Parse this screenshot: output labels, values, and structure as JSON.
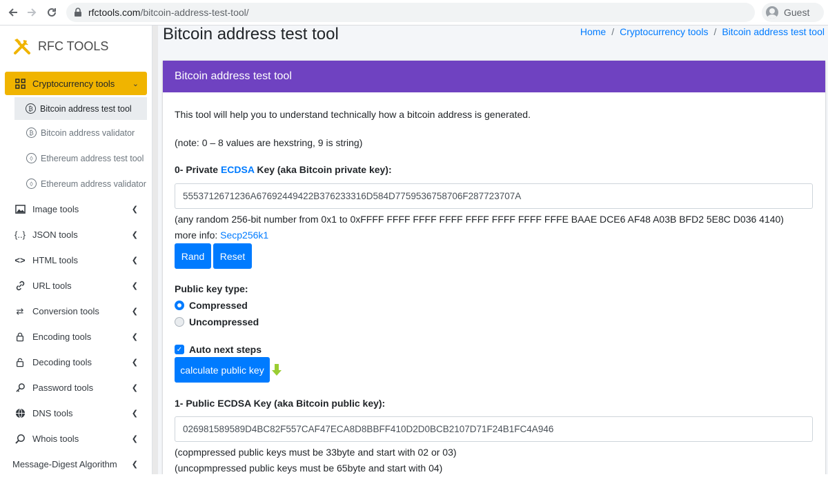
{
  "browser": {
    "url_host": "rfctools.com",
    "url_path": "/bitcoin-address-test-tool/",
    "profile_label": "Guest"
  },
  "sidebar": {
    "brand": "RFC TOOLS",
    "items": [
      {
        "label": "Cryptocurrency tools",
        "icon": "grid-icon",
        "active": true
      },
      {
        "label": "Image tools",
        "icon": "image-icon"
      },
      {
        "label": "JSON tools",
        "icon": "braces-icon"
      },
      {
        "label": "HTML tools",
        "icon": "code-icon"
      },
      {
        "label": "URL tools",
        "icon": "link-icon"
      },
      {
        "label": "Conversion tools",
        "icon": "sync-icon"
      },
      {
        "label": "Encoding tools",
        "icon": "lock-icon"
      },
      {
        "label": "Decoding tools",
        "icon": "unlock-icon"
      },
      {
        "label": "Password tools",
        "icon": "key-icon"
      },
      {
        "label": "DNS tools",
        "icon": "globe-icon"
      },
      {
        "label": "Whois tools",
        "icon": "search-icon"
      },
      {
        "label": "Message-Digest Algorithm"
      }
    ],
    "subitems": [
      {
        "label": "Bitcoin address test tool",
        "icon": "bitcoin-icon",
        "current": true
      },
      {
        "label": "Bitcoin address validator",
        "icon": "bitcoin-icon"
      },
      {
        "label": "Ethereum address test tool",
        "icon": "ethereum-icon"
      },
      {
        "label": "Ethereum address validator",
        "icon": "ethereum-icon"
      }
    ]
  },
  "main": {
    "title": "Bitcoin address test tool",
    "breadcrumb": [
      "Home",
      "Cryptocurrency tools",
      "Bitcoin address test tool"
    ],
    "card_title": "Bitcoin address test tool",
    "intro": "This tool will help you to understand technically how a bitcoin address is generated.",
    "note": "(note: 0 – 8 values are hexstring, 9 is string)",
    "step0_prefix": "0- Private ",
    "step0_link": "ECDSA",
    "step0_suffix": " Key (aka Bitcoin private key):",
    "private_key": "5553712671236A67692449422B376233316D584D7759536758706F287723707A",
    "private_key_hint": "(any random 256-bit number from 0x1 to 0xFFFF FFFF FFFF FFFF FFFF FFFF FFFF FFFE BAAE DCE6 AF48 A03B BFD2 5E8C D036 4140)",
    "more_info_prefix": "more info: ",
    "more_info_link": "Secp256k1",
    "rand_button": "Rand",
    "reset_button": "Reset",
    "pubkey_type_label": "Public key type:",
    "radio_compressed": "Compressed",
    "radio_uncompressed": "Uncompressed",
    "auto_next_label": "Auto next steps",
    "calc_button": "calculate public key",
    "step1_label": "1- Public ECDSA Key (aka Bitcoin public key):",
    "public_key": "026981589589D4BC82F557CAF47ECA8D8BBFF410D2D0BCB2107D71F24B1FC4A946",
    "pubkey_hint1": "(copmpressed public keys must be 33byte and start with 02 or 03)",
    "pubkey_hint2": "(uncopmpressed public keys must be 65byte and start with 04)"
  },
  "colors": {
    "card_header": "#6f42c1",
    "active_menu": "#f0b400",
    "primary": "#007bff",
    "arrow": "#9acd32"
  }
}
